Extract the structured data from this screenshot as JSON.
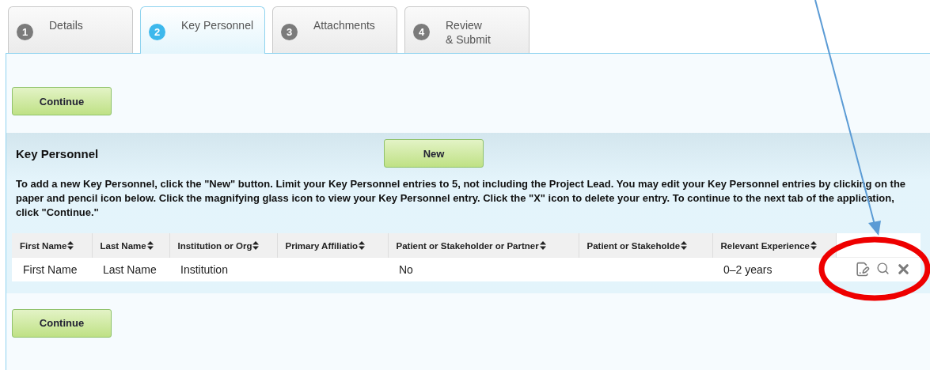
{
  "tabs": [
    {
      "number": "1",
      "label": "Details",
      "selected": false
    },
    {
      "number": "2",
      "label": "Key Personnel",
      "selected": true
    },
    {
      "number": "3",
      "label": "Attachments",
      "selected": false
    },
    {
      "number": "4",
      "label": "Review\n& Submit",
      "selected": false
    }
  ],
  "top_button": "Continue",
  "section": {
    "title": "Key Personnel",
    "new_button": "New",
    "instructions": "To add a new Key Personnel, click the \"New\" button. Limit your Key Personnel entries to 5, not including the Project Lead. You may edit your Key Personnel entries by clicking on the paper and pencil icon below. Click the magnifying glass icon to view your Key Personnel entry. Click the \"X\" icon to delete your entry. To continue to the next tab of the application, click \"Continue.\""
  },
  "table": {
    "columns": [
      "First Name",
      "Last Name",
      "Institution or Org",
      "Primary Affiliatio",
      "Patient or Stakeholder or Partner",
      "Patient or Stakeholde",
      "Relevant Experience"
    ],
    "rows": [
      {
        "cells": [
          "First Name",
          "Last Name",
          "Institution",
          "",
          "No",
          "",
          "0–2 years"
        ]
      }
    ]
  },
  "bottom_button": "Continue"
}
